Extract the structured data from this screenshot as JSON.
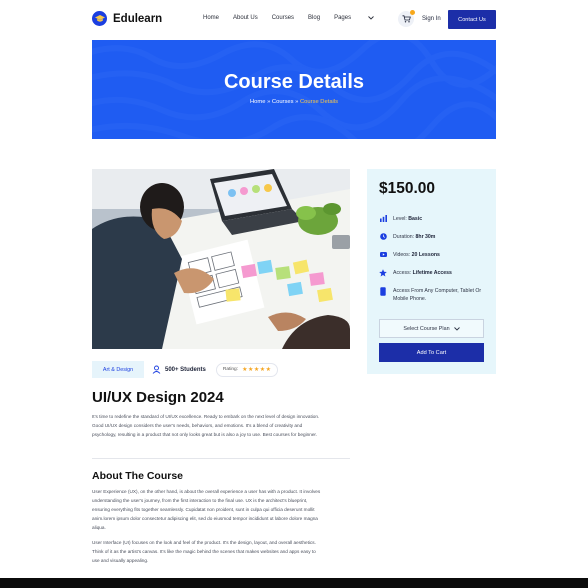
{
  "brand": {
    "name": "Edulearn"
  },
  "nav": {
    "items": [
      "Home",
      "About Us",
      "Courses",
      "Blog"
    ],
    "pages_label": "Pages"
  },
  "header": {
    "sign_in": "Sign In",
    "contact": "Contact Us"
  },
  "hero": {
    "title": "Course Details",
    "crumb_home": "Home",
    "crumb_sep": "»",
    "crumb_courses": "Courses",
    "crumb_current": "Course Details"
  },
  "course": {
    "category": "Art & Design",
    "students": "500+ Students",
    "rating_label": "Rating:",
    "rating_stars": "★★★★★",
    "title": "UI/UX Design 2024",
    "intro": "It's time to redefine the standard of UI/UX excellence. Ready to embark on the next level of design innovation. Good UI/UX design considers the user's needs, behaviors, and emotions. It's a blend of creativity and psychology, resulting in a product that not only looks great but is also a joy to use. Best courses for beginner.",
    "about_title": "About The Course",
    "about_p1": "User Experience (UX), on the other hand, is about the overall experience a user has with a product. It involves understanding the user's journey, from the first interaction to the final use. UX is the architect's blueprint, ensuring everything fits together seamlessly. Cupidatat non proident, sunt in culpa qui officia deserunt mollit anim.lorem ipsum dolor consectetur adipiscing elit, sed do eiusmod tempor incididunt ut labore dolore magna aliqua.",
    "about_p2": "User Interface (UI) focuses on the look and feel of the product. It's the design, layout, and overall aesthetics. Think of it as the artist's canvas. It's like the magic behind the scenes that makes websites and apps easy to use and visually appealing."
  },
  "sidebar": {
    "price": "$150.00",
    "level_label": "Level:",
    "level_value": "Basic",
    "duration_label": "Duration:",
    "duration_value": "8hr 30m",
    "videos_label": "Videos:",
    "videos_value": "20 Lessons",
    "access_label": "Access:",
    "access_value": "Lifetime Access",
    "access_devices": "Access From Any Computer, Tablet Or Mobile Phone.",
    "select_plan": "Select Course Plan",
    "add_to_cart": "Add To Cart"
  },
  "colors": {
    "primary": "#1c2ea8",
    "hero": "#1f5cf2",
    "accent": "#f7c84b",
    "sidebar_bg": "#e6f6fb"
  }
}
